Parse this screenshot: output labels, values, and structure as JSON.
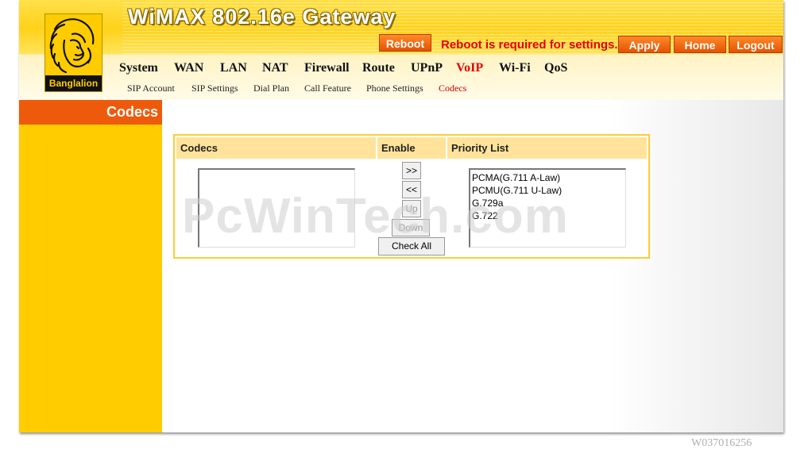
{
  "header": {
    "title": "WiMAX 802.16e Gateway",
    "logo_label": "Banglalion",
    "reboot_button": "Reboot",
    "reboot_message": "Reboot is required for settings.",
    "apply_button": "Apply",
    "home_button": "Home",
    "logout_button": "Logout"
  },
  "nav": {
    "main": [
      {
        "label": "System"
      },
      {
        "label": "WAN"
      },
      {
        "label": "LAN"
      },
      {
        "label": "NAT"
      },
      {
        "label": "Firewall"
      },
      {
        "label": "Route"
      },
      {
        "label": "UPnP"
      },
      {
        "label": "VoIP",
        "active": true
      },
      {
        "label": "Wi-Fi"
      },
      {
        "label": "QoS"
      }
    ],
    "sub": [
      {
        "label": "SIP Account"
      },
      {
        "label": "SIP Settings"
      },
      {
        "label": "Dial Plan"
      },
      {
        "label": "Call Feature"
      },
      {
        "label": "Phone Settings"
      },
      {
        "label": "Codecs",
        "active": true
      }
    ]
  },
  "sidebar": {
    "title": "Codecs"
  },
  "codecs_table": {
    "headers": [
      "Codecs",
      "Enable",
      "Priority List"
    ],
    "available_codecs": [],
    "priority_list": [
      "PCMA(G.711 A-Law)",
      "PCMU(G.711 U-Law)",
      "G.729a",
      "G.722"
    ],
    "buttons": {
      "add": ">>",
      "remove": "<<",
      "up": "Up",
      "down": "Down",
      "check_all": "Check All"
    }
  },
  "watermark": "PcWinTech.com",
  "image_id": "W037016256",
  "colors": {
    "header_yellow": "#ffd21a",
    "sidebar_yellow": "#ffcc00",
    "accent_orange": "#ee5a0c",
    "alert_red": "#e60000"
  }
}
